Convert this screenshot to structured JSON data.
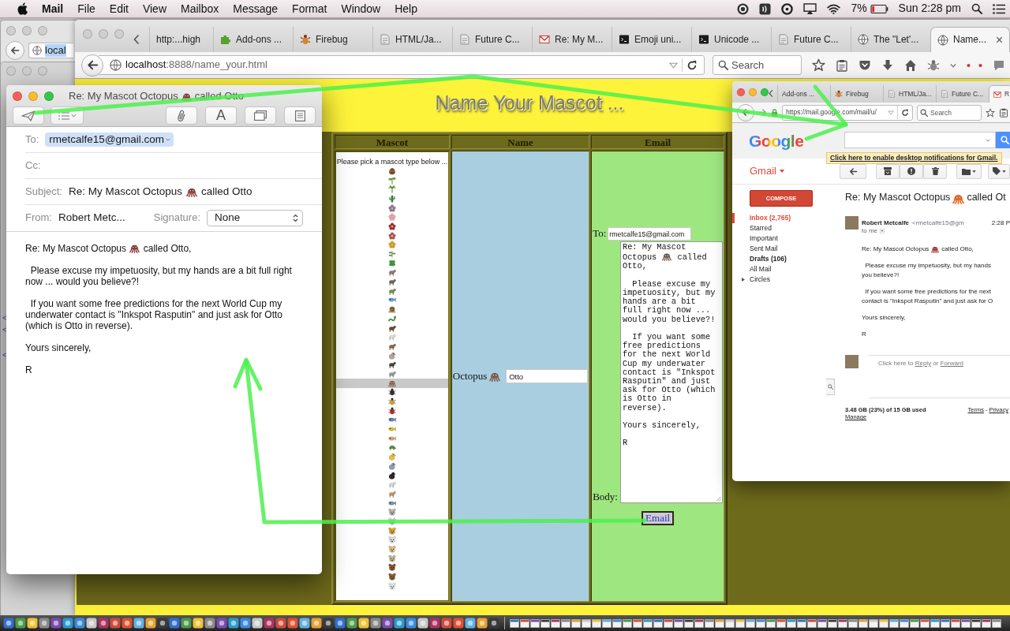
{
  "menu_bar": {
    "app": "Mail",
    "menus": [
      "File",
      "Edit",
      "View",
      "Mailbox",
      "Message",
      "Format",
      "Window",
      "Help"
    ],
    "battery": "7%",
    "clock": "Sun 2:28 pm"
  },
  "background_window": {
    "url": "local",
    "code": [
      "<",
      "<",
      "<"
    ]
  },
  "browser": {
    "tabs": [
      {
        "label": "http:...high",
        "kind": "plain",
        "selected": false
      },
      {
        "label": "Add-ons ...",
        "kind": "addon",
        "selected": false
      },
      {
        "label": "Firebug",
        "kind": "debugger",
        "selected": false
      },
      {
        "label": "HTML/Ja...",
        "kind": "doc",
        "selected": false
      },
      {
        "label": "Future C...",
        "kind": "doc",
        "selected": false
      },
      {
        "label": "Re: My M...",
        "kind": "mail",
        "selected": false
      },
      {
        "label": "Emoji uni...",
        "kind": "terminal",
        "selected": false
      },
      {
        "label": "Unicode ...",
        "kind": "terminal",
        "selected": false
      },
      {
        "label": "Future C...",
        "kind": "doc",
        "selected": false
      },
      {
        "label": "The \"Let'...",
        "kind": "site",
        "selected": false
      },
      {
        "label": "Name...",
        "kind": "site",
        "selected": true
      }
    ],
    "url_host": "localhost",
    "url_path": ":8888/name_your.html",
    "search_placeholder": "Search"
  },
  "page": {
    "title": "Name Your Mascot ...",
    "columns": [
      "Mascot",
      "Name",
      "Email"
    ],
    "mascot_list": {
      "prompt": "Please pick a mascot type below ...",
      "options": [
        {
          "kind": "chestnut",
          "selected": false
        },
        {
          "kind": "seedling",
          "selected": false
        },
        {
          "kind": "palm",
          "selected": false
        },
        {
          "kind": "cactus",
          "selected": false
        },
        {
          "kind": "tulip",
          "selected": false
        },
        {
          "kind": "blossom",
          "selected": false
        },
        {
          "kind": "rose",
          "selected": false
        },
        {
          "kind": "hibiscus",
          "selected": false
        },
        {
          "kind": "sunflower",
          "selected": false
        },
        {
          "kind": "herb",
          "selected": false
        },
        {
          "kind": "clover",
          "selected": false
        },
        {
          "kind": "rat",
          "selected": false
        },
        {
          "kind": "mouse",
          "selected": false
        },
        {
          "kind": "crocodile",
          "selected": false
        },
        {
          "kind": "whale",
          "selected": false
        },
        {
          "kind": "snail",
          "selected": false
        },
        {
          "kind": "snake",
          "selected": false
        },
        {
          "kind": "horse",
          "selected": false
        },
        {
          "kind": "sheep",
          "selected": false
        },
        {
          "kind": "monkey",
          "selected": false
        },
        {
          "kind": "rooster",
          "selected": false
        },
        {
          "kind": "boar",
          "selected": false
        },
        {
          "kind": "elephant",
          "selected": false
        },
        {
          "kind": "octopus",
          "selected": true
        },
        {
          "kind": "ant",
          "selected": false
        },
        {
          "kind": "bee",
          "selected": false
        },
        {
          "kind": "ladybug",
          "selected": false
        },
        {
          "kind": "fish",
          "selected": false
        },
        {
          "kind": "tropicalfish",
          "selected": false
        },
        {
          "kind": "blowfish",
          "selected": false
        },
        {
          "kind": "turtle",
          "selected": false
        },
        {
          "kind": "chick",
          "selected": false
        },
        {
          "kind": "bird",
          "selected": false
        },
        {
          "kind": "penguin",
          "selected": false
        },
        {
          "kind": "poodle",
          "selected": false
        },
        {
          "kind": "camel",
          "selected": false
        },
        {
          "kind": "dolphin",
          "selected": false
        },
        {
          "kind": "mouseface",
          "selected": false
        },
        {
          "kind": "cowface",
          "selected": false
        },
        {
          "kind": "tigerface",
          "selected": false
        },
        {
          "kind": "rabbitface",
          "selected": false
        },
        {
          "kind": "catface",
          "selected": false
        },
        {
          "kind": "dogface",
          "selected": false
        },
        {
          "kind": "horseface",
          "selected": false
        },
        {
          "kind": "bearface",
          "selected": false
        },
        {
          "kind": "panda",
          "selected": false
        }
      ]
    },
    "name_cell": {
      "label": "Octopus",
      "kind": "octopus",
      "value": "Otto"
    },
    "email_cell": {
      "to_label": "To:",
      "to_value": "rmetcalfe15@gmail.com",
      "body_label": "Body:",
      "body": [
        {
          "before": "Re: My Mascot Octopus",
          "kind": "octopus",
          "after": "called Otto,"
        },
        {
          "text": "  Please excuse my impetuosity, but my hands are a bit full right now ... would you believe?!"
        },
        {
          "text": "  If you want some free predictions for the next World Cup my underwater contact is \"Inkspot Rasputin\" and just ask for Otto (which is Otto in reverse)."
        },
        {
          "text": "Yours sincerely,"
        },
        {
          "text": "R"
        }
      ],
      "button": "Email"
    }
  },
  "mail_window": {
    "title": {
      "before": "Re: My Mascot Octopus",
      "kind": "octopus",
      "after": "called Otto"
    },
    "font_button": "A",
    "to_label": "To:",
    "to_value": "rmetcalfe15@gmail.com",
    "cc_label": "Cc:",
    "subject_label": "Subject:",
    "subject": {
      "before": "Re: My Mascot Octopus",
      "kind": "octopus",
      "after": "called Otto"
    },
    "from_label": "From:",
    "from_value": "Robert Metc...",
    "signature_label": "Signature:",
    "signature_value": "None",
    "body": [
      {
        "before": "Re: My Mascot Octopus",
        "kind": "octopus",
        "after": "called Otto,"
      },
      {
        "text": "  Please excuse my impetuosity, but my hands are a bit full right now ... would you believe?!"
      },
      {
        "text": "  If you want some free predictions for the next World Cup my underwater contact is \"Inkspot Rasputin\" and just ask for Otto (which is Otto in reverse)."
      },
      {
        "text": "Yours sincerely,"
      },
      {
        "text": "R"
      }
    ]
  },
  "gmail_window": {
    "tabs": [
      {
        "label": "Add-ons ...",
        "kind": "plain",
        "selected": false
      },
      {
        "label": "Firebug",
        "kind": "debugger",
        "selected": false
      },
      {
        "label": "HTML/Ja...",
        "kind": "doc",
        "selected": false
      },
      {
        "label": "Future C...",
        "kind": "doc",
        "selected": false
      },
      {
        "label": "R",
        "kind": "mail",
        "selected": true
      }
    ],
    "url": "https://mail.google.com/mail/u/",
    "search_placeholder": "Search",
    "logo": "Google",
    "notification": "Click here to enable desktop notifications for Gmail.",
    "app_menu": "Gmail",
    "compose": "COMPOSE",
    "folders": [
      {
        "label": "Inbox (2,765)",
        "selected": true,
        "unread": true
      },
      {
        "label": "Starred",
        "selected": false,
        "unread": false
      },
      {
        "label": "Important",
        "selected": false,
        "unread": false
      },
      {
        "label": "Sent Mail",
        "selected": false,
        "unread": false
      },
      {
        "label": "Drafts (106)",
        "selected": false,
        "unread": true
      },
      {
        "label": "All Mail",
        "selected": false,
        "unread": false
      },
      {
        "label": "Circles",
        "selected": false,
        "unread": false,
        "expanded": false
      }
    ],
    "subject": {
      "before": "Re: My Mascot Octopus",
      "kind": "octopus",
      "after": "called Ot"
    },
    "sender_name": "Robert Metcalfe",
    "sender_email": "<rmetcalfe15@gm",
    "time": "2:28 P",
    "recipient": "to me",
    "body": [
      {
        "before": "Re: My Mascot Octopus",
        "kind": "octopus",
        "after": "called Otto,"
      },
      {
        "lines": [
          "  Please excuse my impetuosity, but my hands",
          "you believe?!"
        ]
      },
      {
        "lines": [
          "  If you want some free predictions for the next",
          "contact is \"Inkspot Rasputin\" and just ask for O"
        ]
      },
      {
        "lines": [
          "Yours sincerely,"
        ]
      },
      {
        "lines": [
          "R"
        ]
      }
    ],
    "reply_prompt": {
      "before": "Click here to",
      "reply": "Reply",
      "middle": "or",
      "forward": "Forward"
    },
    "storage": "3.48 GB (23%) of 15 GB used",
    "manage": "Manage",
    "terms": "Terms",
    "separator": "-",
    "privacy": "Privacy"
  }
}
